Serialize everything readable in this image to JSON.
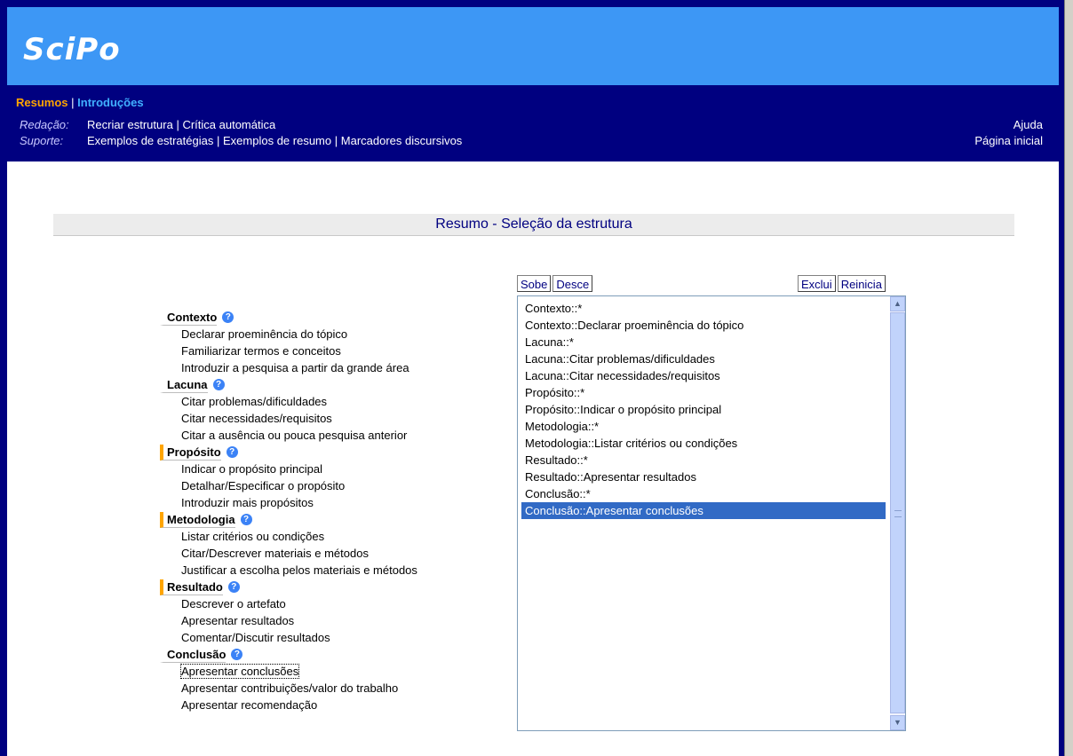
{
  "app": {
    "logo": "SciPo"
  },
  "nav": {
    "tabs": [
      "Resumos",
      "Introduções"
    ],
    "separator": "|",
    "redacao": {
      "label": "Redação:",
      "links": [
        "Recriar estrutura",
        "Crítica automática"
      ]
    },
    "suporte": {
      "label": "Suporte:",
      "links": [
        "Exemplos de estratégias",
        "Exemplos de resumo",
        "Marcadores discursivos"
      ]
    },
    "right": [
      "Ajuda",
      "Página inicial"
    ]
  },
  "page": {
    "title": "Resumo - Seleção da estrutura"
  },
  "toolbar": {
    "up": "Sobe",
    "down": "Desce",
    "delete": "Exclui",
    "reset": "Reinicia"
  },
  "sections": [
    {
      "name": "Contexto",
      "items": [
        "Declarar proeminência do tópico",
        "Familiarizar termos e conceitos",
        "Introduzir a pesquisa a partir da grande área"
      ]
    },
    {
      "name": "Lacuna",
      "items": [
        "Citar problemas/dificuldades",
        "Citar necessidades/requisitos",
        "Citar a ausência ou pouca pesquisa anterior"
      ]
    },
    {
      "name": "Propósito",
      "items": [
        "Indicar o propósito principal",
        "Detalhar/Especificar o propósito",
        "Introduzir mais propósitos"
      ]
    },
    {
      "name": "Metodologia",
      "items": [
        "Listar critérios ou condições",
        "Citar/Descrever materiais e métodos",
        "Justificar a escolha pelos materiais e métodos"
      ]
    },
    {
      "name": "Resultado",
      "items": [
        "Descrever o artefato",
        "Apresentar resultados",
        "Comentar/Discutir resultados"
      ]
    },
    {
      "name": "Conclusão",
      "items": [
        "Apresentar conclusões",
        "Apresentar contribuições/valor do trabalho",
        "Apresentar recomendação"
      ]
    }
  ],
  "structure_list": {
    "items": [
      "Contexto::*",
      "Contexto::Declarar proeminência do tópico",
      "Lacuna::*",
      "Lacuna::Citar problemas/dificuldades",
      "Lacuna::Citar necessidades/requisitos",
      "Propósito::*",
      "Propósito::Indicar o propósito principal",
      "Metodologia::*",
      "Metodologia::Listar critérios ou condições",
      "Resultado::*",
      "Resultado::Apresentar resultados",
      "Conclusão::*",
      "Conclusão::Apresentar conclusões"
    ],
    "selected": "Conclusão::Apresentar conclusões"
  },
  "colors": {
    "header": "#3d97f5",
    "navbar": "#000080",
    "active_tab": "#ffa500",
    "section_marker": "#ffa500",
    "selection": "#316ac5"
  },
  "icons": {
    "help": "help-circle-icon",
    "scroll_up": "chevron-up-icon",
    "scroll_down": "chevron-down-icon"
  }
}
